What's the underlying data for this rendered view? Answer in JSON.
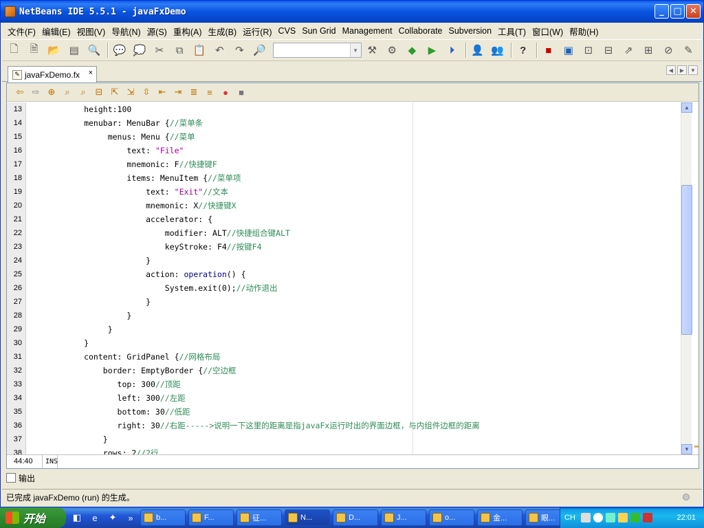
{
  "window": {
    "title": "NetBeans IDE 5.5.1 - javaFxDemo"
  },
  "titlebar_buttons": {
    "minimize": "_",
    "maximize": "□",
    "close": "✕"
  },
  "menu": [
    "文件(F)",
    "编辑(E)",
    "视图(V)",
    "导航(N)",
    "源(S)",
    "重构(A)",
    "生成(B)",
    "运行(R)",
    "CVS",
    "Sun Grid",
    "Management",
    "Collaborate",
    "Subversion",
    "工具(T)",
    "窗口(W)",
    "帮助(H)"
  ],
  "toolbar": {
    "config_combo_value": ""
  },
  "editor_tab": {
    "filename": "javaFxDemo.fx",
    "close": "×"
  },
  "code_lines": [
    {
      "n": "13",
      "t": "            height:100"
    },
    {
      "n": "14",
      "t": "            menubar: MenuBar {//菜单条"
    },
    {
      "n": "15",
      "t": "                 menus: Menu {//菜单"
    },
    {
      "n": "16",
      "t": "                     text: \"File\""
    },
    {
      "n": "17",
      "t": "                     mnemonic: F//快捷键F"
    },
    {
      "n": "18",
      "t": "                     items: MenuItem {//菜单项"
    },
    {
      "n": "19",
      "t": "                         text: \"Exit\"//文本"
    },
    {
      "n": "20",
      "t": "                         mnemonic: X//快捷键X"
    },
    {
      "n": "21",
      "t": "                         accelerator: {"
    },
    {
      "n": "22",
      "t": "                             modifier: ALT//快捷组合键ALT"
    },
    {
      "n": "23",
      "t": "                             keyStroke: F4//按键F4"
    },
    {
      "n": "24",
      "t": "                         }"
    },
    {
      "n": "25",
      "t": "                         action: operation() {"
    },
    {
      "n": "26",
      "t": "                             System.exit(0);//动作退出"
    },
    {
      "n": "27",
      "t": "                         }"
    },
    {
      "n": "28",
      "t": "                     }"
    },
    {
      "n": "29",
      "t": "                 }"
    },
    {
      "n": "30",
      "t": "            }"
    },
    {
      "n": "31",
      "t": "            content: GridPanel {//网格布局"
    },
    {
      "n": "32",
      "t": "                border: EmptyBorder {//空边框"
    },
    {
      "n": "33",
      "t": "                   top: 300//顶距"
    },
    {
      "n": "34",
      "t": "                   left: 300//左距"
    },
    {
      "n": "35",
      "t": "                   bottom: 30//低距"
    },
    {
      "n": "36",
      "t": "                   right: 30//右距----->说明一下这里的距离是指javaFx运行时出的界面边框，与内组件边框的距离"
    },
    {
      "n": "37",
      "t": "                }"
    },
    {
      "n": "38",
      "t": "                rows: 2//2行"
    }
  ],
  "editor_status": {
    "position": "44:40",
    "mode": "INS"
  },
  "output_tab": "输出",
  "status_text": "已完成 javaFxDemo (run) 的生成。",
  "taskbar": {
    "start": "开始",
    "tasks": [
      "b...",
      "F...",
      "征...",
      "N...",
      "D...",
      "J...",
      "o...",
      "金...",
      "眼..."
    ],
    "active_task_index": 3,
    "tray_lang": "CH",
    "clock": "22:01"
  },
  "colors": {
    "comment": "#2e8b57",
    "string": "#a000a0",
    "title_bar": "#0854e0"
  }
}
